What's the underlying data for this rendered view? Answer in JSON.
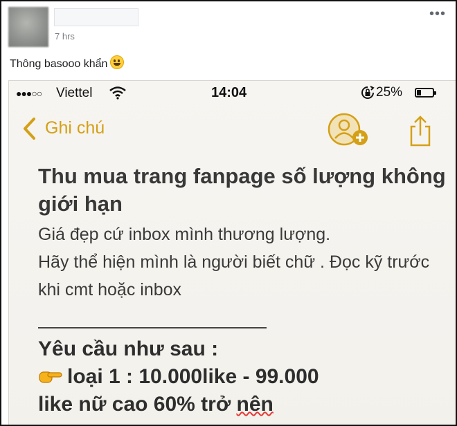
{
  "post": {
    "time": "7 hrs",
    "more_icon": "ellipsis-icon",
    "text": "Thông basooo khẩn",
    "emoji": "grinning-face-icon"
  },
  "phone": {
    "status": {
      "signal": "●●●○○",
      "carrier": "Viettel",
      "time": "14:04",
      "battery": "25%",
      "battery_level": 0.25
    },
    "nav": {
      "back_label": "Ghi chú",
      "accent": "#d4a017"
    },
    "note": {
      "title": "Thu mua trang fanpage số lượng không giới hạn",
      "line1": "Giá đẹp cứ inbox mình thương lượng.",
      "line2": "Hãy thể hiện mình là người biết chữ . Đọc kỹ trước khi cmt hoặc inbox",
      "req_title": "Yêu cầu như sau :",
      "req_item_1": "loại 1 : 10.000like - 99.000",
      "req_item_2a": "like nữ cao 60% trở ",
      "req_item_2b": "nên"
    }
  }
}
